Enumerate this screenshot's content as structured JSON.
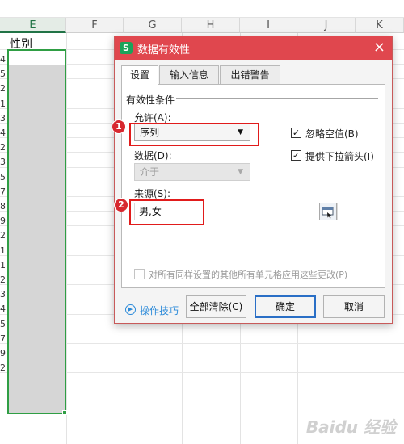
{
  "sheet": {
    "columns": [
      {
        "label": "E",
        "active": true
      },
      {
        "label": "F",
        "active": false
      },
      {
        "label": "G",
        "active": false
      },
      {
        "label": "H",
        "active": false
      },
      {
        "label": "I",
        "active": false
      },
      {
        "label": "J",
        "active": false
      },
      {
        "label": "K",
        "active": false
      }
    ],
    "header_cell": "性别",
    "row_labels": [
      "4",
      "5",
      "2",
      "1",
      "3",
      "4",
      "2",
      "3",
      "5",
      "7",
      "8",
      "9",
      "2",
      "1",
      "1",
      "2",
      "3",
      "4",
      "5",
      "7",
      "9",
      "2"
    ],
    "selection_color": "#2f9e44"
  },
  "dialog": {
    "title": "数据有效性",
    "app_icon_label": "S",
    "title_color": "#e0474e",
    "tabs": [
      "设置",
      "输入信息",
      "出错警告"
    ],
    "active_tab": 0,
    "group_title": "有效性条件",
    "allow_label": "允许(A):",
    "allow_value": "序列",
    "data_label": "数据(D):",
    "data_value": "介于",
    "ignore_blank": {
      "label": "忽略空值(B)",
      "checked": true
    },
    "dropdown_arrow": {
      "label": "提供下拉箭头(I)",
      "checked": true
    },
    "source_label": "来源(S):",
    "source_value": "男,女",
    "apply_all": {
      "label": "对所有同样设置的其他所有单元格应用这些更改(P)",
      "checked": false
    },
    "help_link": "操作技巧",
    "buttons": {
      "clear": "全部清除(C)",
      "ok": "确定",
      "cancel": "取消"
    }
  },
  "annotations": {
    "badge1": "1",
    "badge2": "2",
    "color": "#e11b1b"
  },
  "watermark": "Baidu 经验"
}
